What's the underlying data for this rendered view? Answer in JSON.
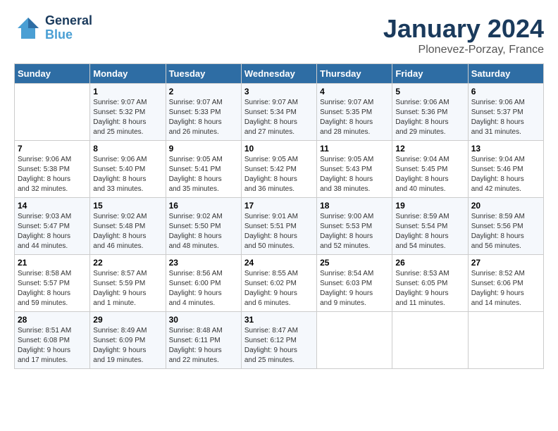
{
  "logo": {
    "line1": "General",
    "line2": "Blue"
  },
  "title": "January 2024",
  "location": "Plonevez-Porzay, France",
  "days_header": [
    "Sunday",
    "Monday",
    "Tuesday",
    "Wednesday",
    "Thursday",
    "Friday",
    "Saturday"
  ],
  "weeks": [
    [
      {
        "num": "",
        "sunrise": "",
        "sunset": "",
        "daylight": ""
      },
      {
        "num": "1",
        "sunrise": "Sunrise: 9:07 AM",
        "sunset": "Sunset: 5:32 PM",
        "daylight": "Daylight: 8 hours and 25 minutes."
      },
      {
        "num": "2",
        "sunrise": "Sunrise: 9:07 AM",
        "sunset": "Sunset: 5:33 PM",
        "daylight": "Daylight: 8 hours and 26 minutes."
      },
      {
        "num": "3",
        "sunrise": "Sunrise: 9:07 AM",
        "sunset": "Sunset: 5:34 PM",
        "daylight": "Daylight: 8 hours and 27 minutes."
      },
      {
        "num": "4",
        "sunrise": "Sunrise: 9:07 AM",
        "sunset": "Sunset: 5:35 PM",
        "daylight": "Daylight: 8 hours and 28 minutes."
      },
      {
        "num": "5",
        "sunrise": "Sunrise: 9:06 AM",
        "sunset": "Sunset: 5:36 PM",
        "daylight": "Daylight: 8 hours and 29 minutes."
      },
      {
        "num": "6",
        "sunrise": "Sunrise: 9:06 AM",
        "sunset": "Sunset: 5:37 PM",
        "daylight": "Daylight: 8 hours and 31 minutes."
      }
    ],
    [
      {
        "num": "7",
        "sunrise": "Sunrise: 9:06 AM",
        "sunset": "Sunset: 5:38 PM",
        "daylight": "Daylight: 8 hours and 32 minutes."
      },
      {
        "num": "8",
        "sunrise": "Sunrise: 9:06 AM",
        "sunset": "Sunset: 5:40 PM",
        "daylight": "Daylight: 8 hours and 33 minutes."
      },
      {
        "num": "9",
        "sunrise": "Sunrise: 9:05 AM",
        "sunset": "Sunset: 5:41 PM",
        "daylight": "Daylight: 8 hours and 35 minutes."
      },
      {
        "num": "10",
        "sunrise": "Sunrise: 9:05 AM",
        "sunset": "Sunset: 5:42 PM",
        "daylight": "Daylight: 8 hours and 36 minutes."
      },
      {
        "num": "11",
        "sunrise": "Sunrise: 9:05 AM",
        "sunset": "Sunset: 5:43 PM",
        "daylight": "Daylight: 8 hours and 38 minutes."
      },
      {
        "num": "12",
        "sunrise": "Sunrise: 9:04 AM",
        "sunset": "Sunset: 5:45 PM",
        "daylight": "Daylight: 8 hours and 40 minutes."
      },
      {
        "num": "13",
        "sunrise": "Sunrise: 9:04 AM",
        "sunset": "Sunset: 5:46 PM",
        "daylight": "Daylight: 8 hours and 42 minutes."
      }
    ],
    [
      {
        "num": "14",
        "sunrise": "Sunrise: 9:03 AM",
        "sunset": "Sunset: 5:47 PM",
        "daylight": "Daylight: 8 hours and 44 minutes."
      },
      {
        "num": "15",
        "sunrise": "Sunrise: 9:02 AM",
        "sunset": "Sunset: 5:48 PM",
        "daylight": "Daylight: 8 hours and 46 minutes."
      },
      {
        "num": "16",
        "sunrise": "Sunrise: 9:02 AM",
        "sunset": "Sunset: 5:50 PM",
        "daylight": "Daylight: 8 hours and 48 minutes."
      },
      {
        "num": "17",
        "sunrise": "Sunrise: 9:01 AM",
        "sunset": "Sunset: 5:51 PM",
        "daylight": "Daylight: 8 hours and 50 minutes."
      },
      {
        "num": "18",
        "sunrise": "Sunrise: 9:00 AM",
        "sunset": "Sunset: 5:53 PM",
        "daylight": "Daylight: 8 hours and 52 minutes."
      },
      {
        "num": "19",
        "sunrise": "Sunrise: 8:59 AM",
        "sunset": "Sunset: 5:54 PM",
        "daylight": "Daylight: 8 hours and 54 minutes."
      },
      {
        "num": "20",
        "sunrise": "Sunrise: 8:59 AM",
        "sunset": "Sunset: 5:56 PM",
        "daylight": "Daylight: 8 hours and 56 minutes."
      }
    ],
    [
      {
        "num": "21",
        "sunrise": "Sunrise: 8:58 AM",
        "sunset": "Sunset: 5:57 PM",
        "daylight": "Daylight: 8 hours and 59 minutes."
      },
      {
        "num": "22",
        "sunrise": "Sunrise: 8:57 AM",
        "sunset": "Sunset: 5:59 PM",
        "daylight": "Daylight: 9 hours and 1 minute."
      },
      {
        "num": "23",
        "sunrise": "Sunrise: 8:56 AM",
        "sunset": "Sunset: 6:00 PM",
        "daylight": "Daylight: 9 hours and 4 minutes."
      },
      {
        "num": "24",
        "sunrise": "Sunrise: 8:55 AM",
        "sunset": "Sunset: 6:02 PM",
        "daylight": "Daylight: 9 hours and 6 minutes."
      },
      {
        "num": "25",
        "sunrise": "Sunrise: 8:54 AM",
        "sunset": "Sunset: 6:03 PM",
        "daylight": "Daylight: 9 hours and 9 minutes."
      },
      {
        "num": "26",
        "sunrise": "Sunrise: 8:53 AM",
        "sunset": "Sunset: 6:05 PM",
        "daylight": "Daylight: 9 hours and 11 minutes."
      },
      {
        "num": "27",
        "sunrise": "Sunrise: 8:52 AM",
        "sunset": "Sunset: 6:06 PM",
        "daylight": "Daylight: 9 hours and 14 minutes."
      }
    ],
    [
      {
        "num": "28",
        "sunrise": "Sunrise: 8:51 AM",
        "sunset": "Sunset: 6:08 PM",
        "daylight": "Daylight: 9 hours and 17 minutes."
      },
      {
        "num": "29",
        "sunrise": "Sunrise: 8:49 AM",
        "sunset": "Sunset: 6:09 PM",
        "daylight": "Daylight: 9 hours and 19 minutes."
      },
      {
        "num": "30",
        "sunrise": "Sunrise: 8:48 AM",
        "sunset": "Sunset: 6:11 PM",
        "daylight": "Daylight: 9 hours and 22 minutes."
      },
      {
        "num": "31",
        "sunrise": "Sunrise: 8:47 AM",
        "sunset": "Sunset: 6:12 PM",
        "daylight": "Daylight: 9 hours and 25 minutes."
      },
      {
        "num": "",
        "sunrise": "",
        "sunset": "",
        "daylight": ""
      },
      {
        "num": "",
        "sunrise": "",
        "sunset": "",
        "daylight": ""
      },
      {
        "num": "",
        "sunrise": "",
        "sunset": "",
        "daylight": ""
      }
    ]
  ]
}
